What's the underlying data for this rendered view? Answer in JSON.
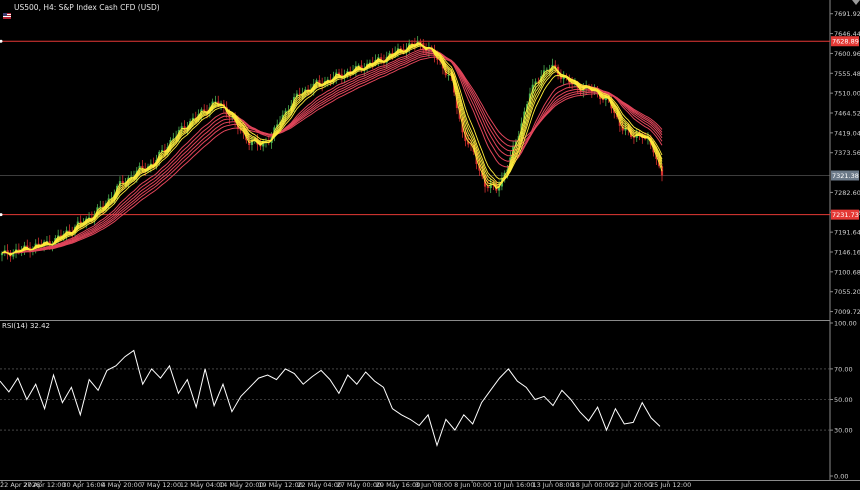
{
  "header": {
    "symbol": "US500, H4:",
    "description": "S&P Index Cash CFD (USD)"
  },
  "rsi": {
    "label": "RSI(14) 32.42"
  },
  "colors": {
    "background": "#000000",
    "bull_candle": "#4caf50",
    "bear_candle": "#d32f2f",
    "fast_ma": "#ffeb3b",
    "slow_ma": "#e0455a",
    "level_line": "#e53935",
    "rsi_line": "#ffffff",
    "axis_text": "#cfcfcf"
  },
  "chart_data": [
    {
      "type": "candlestick",
      "symbol": "US500",
      "timeframe": "H4",
      "y_ticks": [
        7691.92,
        7646.44,
        7600.96,
        7555.48,
        7510.0,
        7464.52,
        7419.04,
        7373.56,
        7282.6,
        7237.12,
        7191.64,
        7146.16,
        7100.68,
        7055.2,
        7009.72
      ],
      "ylim": [
        6995,
        7705
      ],
      "price_labels": {
        "upper_level": 7628.89,
        "current_price": 7321.38,
        "lower_level": 7231.73
      },
      "x_tick_labels": [
        "22 Apr 2026",
        "27 Apr 12:00",
        "30 Apr 16:00",
        "4 May 20:00",
        "7 May 12:00",
        "12 May 04:00",
        "14 May 20:00",
        "19 May 12:00",
        "22 May 04:00",
        "27 May 00:00",
        "29 May 16:00",
        "3 Jun 08:00",
        "8 Jun 00:00",
        "10 Jun 16:00",
        "13 Jun 08:00",
        "18 Jun 00:00",
        "22 Jun 20:00",
        "25 Jun 12:00"
      ],
      "close_path": [
        [
          0,
          7140
        ],
        [
          6,
          7150
        ],
        [
          12,
          7160
        ],
        [
          18,
          7170
        ],
        [
          24,
          7195
        ],
        [
          30,
          7220
        ],
        [
          36,
          7250
        ],
        [
          42,
          7300
        ],
        [
          48,
          7330
        ],
        [
          54,
          7350
        ],
        [
          60,
          7400
        ],
        [
          66,
          7440
        ],
        [
          72,
          7470
        ],
        [
          76,
          7490
        ],
        [
          80,
          7470
        ],
        [
          84,
          7430
        ],
        [
          88,
          7400
        ],
        [
          92,
          7390
        ],
        [
          96,
          7410
        ],
        [
          100,
          7460
        ],
        [
          106,
          7510
        ],
        [
          112,
          7530
        ],
        [
          118,
          7545
        ],
        [
          124,
          7560
        ],
        [
          130,
          7575
        ],
        [
          136,
          7590
        ],
        [
          142,
          7610
        ],
        [
          148,
          7625
        ],
        [
          152,
          7610
        ],
        [
          156,
          7580
        ],
        [
          160,
          7540
        ],
        [
          164,
          7420
        ],
        [
          168,
          7370
        ],
        [
          172,
          7300
        ],
        [
          176,
          7290
        ],
        [
          180,
          7340
        ],
        [
          184,
          7420
        ],
        [
          188,
          7510
        ],
        [
          192,
          7555
        ],
        [
          196,
          7570
        ],
        [
          200,
          7545
        ],
        [
          204,
          7525
        ],
        [
          208,
          7520
        ],
        [
          212,
          7510
        ],
        [
          216,
          7490
        ],
        [
          220,
          7440
        ],
        [
          224,
          7410
        ],
        [
          228,
          7415
        ],
        [
          232,
          7380
        ],
        [
          235,
          7321.38
        ]
      ],
      "moving_averages": {
        "fast_periods": 6,
        "slow_periods": 6
      }
    },
    {
      "type": "line",
      "indicator": "RSI",
      "period": 14,
      "value": 32.42,
      "ylim": [
        0,
        100
      ],
      "y_ticks": [
        100.0,
        70.0,
        50.0,
        30.0,
        0.0
      ],
      "levels": [
        70,
        50,
        30
      ],
      "values": [
        62,
        55,
        64,
        50,
        60,
        44,
        66,
        48,
        58,
        40,
        63,
        56,
        69,
        72,
        78,
        82,
        60,
        70,
        64,
        72,
        54,
        63,
        45,
        70,
        46,
        60,
        42,
        52,
        58,
        64,
        66,
        63,
        70,
        67,
        60,
        65,
        69,
        63,
        54,
        66,
        60,
        68,
        62,
        58,
        44,
        40,
        37,
        33,
        40,
        20,
        37,
        30,
        40,
        34,
        48,
        56,
        64,
        70,
        62,
        58,
        50,
        52,
        46,
        56,
        50,
        42,
        36,
        45,
        30,
        44,
        34,
        35,
        48,
        38,
        32.42
      ]
    }
  ]
}
